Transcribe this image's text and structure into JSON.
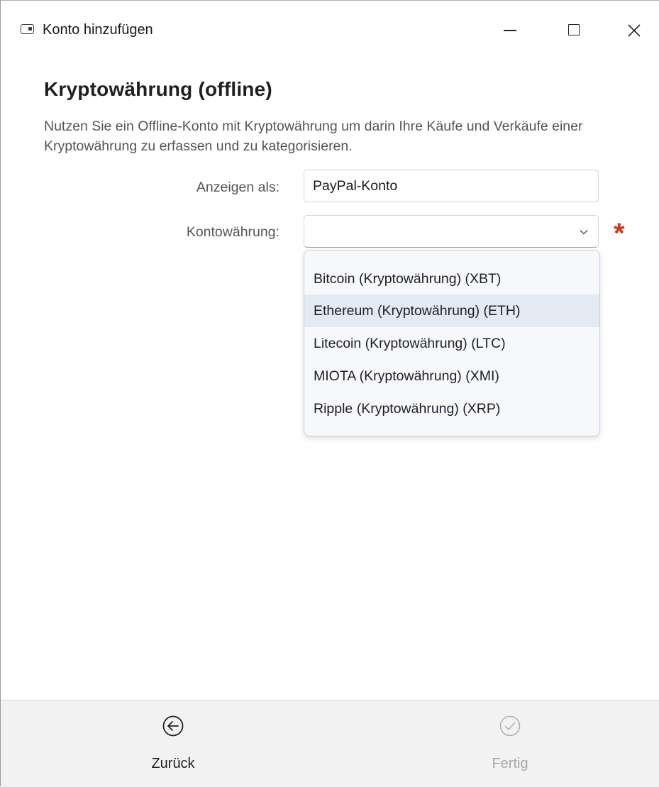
{
  "window": {
    "title": "Konto hinzufügen",
    "icon": "wallet-icon"
  },
  "page": {
    "heading": "Kryptowährung (offline)",
    "description": "Nutzen Sie ein Offline-Konto mit Kryptowährung um darin Ihre Käufe und Verkäufe einer Kryptowährung zu erfassen und zu kategorisieren."
  },
  "form": {
    "display_label": "Anzeigen als:",
    "display_value": "PayPal-Konto",
    "currency_label": "Kontowährung:",
    "currency_value": "",
    "required_marker": "*"
  },
  "dropdown": {
    "options": [
      "Bitcoin (Kryptowährung) (XBT)",
      "Ethereum (Kryptowährung) (ETH)",
      "Litecoin (Kryptowährung) (LTC)",
      "MIOTA (Kryptowährung) (XMI)",
      "Ripple (Kryptowährung) (XRP)"
    ],
    "hovered_index": 1
  },
  "footer": {
    "back_label": "Zurück",
    "done_label": "Fertig"
  },
  "colors": {
    "required": "#cc3a1b",
    "hover": "#e4eaf4",
    "disabled": "#a8a8a8"
  }
}
